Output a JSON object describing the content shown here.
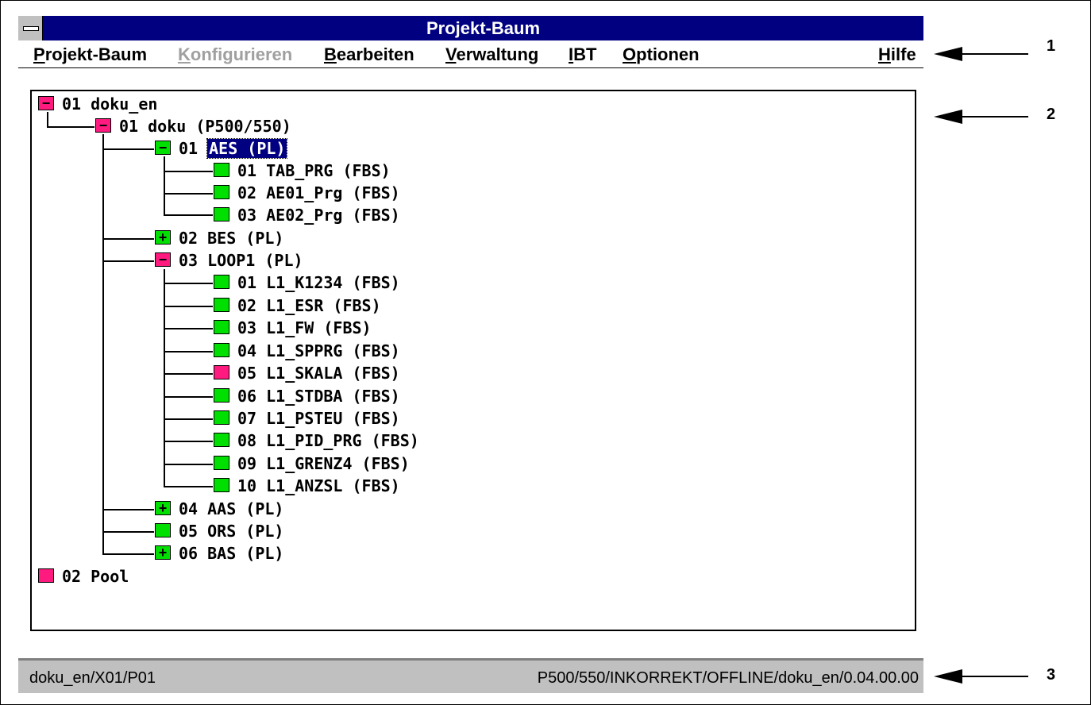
{
  "window": {
    "title": "Projekt-Baum"
  },
  "menubar": {
    "items": [
      {
        "label": "Projekt-Baum",
        "mnemonic": "P",
        "rest": "rojekt-Baum",
        "enabled": true
      },
      {
        "label": "Konfigurieren",
        "mnemonic": "K",
        "rest": "onfigurieren",
        "enabled": false
      },
      {
        "label": "Bearbeiten",
        "mnemonic": "B",
        "rest": "earbeiten",
        "enabled": true
      },
      {
        "label": "Verwaltung",
        "mnemonic": "V",
        "rest": "erwaltung",
        "enabled": true
      },
      {
        "label": "IBT",
        "mnemonic": "I",
        "rest": "BT",
        "enabled": true
      },
      {
        "label": "Optionen",
        "mnemonic": "O",
        "rest": "ptionen",
        "enabled": true
      },
      {
        "label": "Hilfe",
        "mnemonic": "H",
        "rest": "ilfe",
        "enabled": true
      }
    ]
  },
  "tree": {
    "nodes": [
      {
        "label": "01  doku_en",
        "state": "expanded",
        "color": "pink",
        "icon": "minus-icon"
      },
      {
        "label": "01  doku (P500/550)",
        "state": "expanded",
        "color": "pink",
        "icon": "minus-icon"
      },
      {
        "label": "01  ",
        "label_selected": "AES (PL)",
        "state": "expanded",
        "color": "green",
        "icon": "minus-icon",
        "selected": true
      },
      {
        "label": "01  TAB_PRG (FBS)",
        "state": "leaf",
        "color": "green"
      },
      {
        "label": "02  AE01_Prg (FBS)",
        "state": "leaf",
        "color": "green"
      },
      {
        "label": "03  AE02_Prg (FBS)",
        "state": "leaf",
        "color": "green"
      },
      {
        "label": "02  BES (PL)",
        "state": "collapsed",
        "color": "green",
        "icon": "plus-icon"
      },
      {
        "label": "03  LOOP1 (PL)",
        "state": "expanded",
        "color": "pink",
        "icon": "minus-icon"
      },
      {
        "label": "01  L1_K1234 (FBS)",
        "state": "leaf",
        "color": "green"
      },
      {
        "label": "02  L1_ESR (FBS)",
        "state": "leaf",
        "color": "green"
      },
      {
        "label": "03  L1_FW (FBS)",
        "state": "leaf",
        "color": "green"
      },
      {
        "label": "04  L1_SPPRG (FBS)",
        "state": "leaf",
        "color": "green"
      },
      {
        "label": "05  L1_SKALA (FBS)",
        "state": "leaf",
        "color": "pink"
      },
      {
        "label": "06  L1_STDBA (FBS)",
        "state": "leaf",
        "color": "green"
      },
      {
        "label": "07  L1_PSTEU (FBS)",
        "state": "leaf",
        "color": "green"
      },
      {
        "label": "08  L1_PID_PRG (FBS)",
        "state": "leaf",
        "color": "green"
      },
      {
        "label": "09  L1_GRENZ4 (FBS)",
        "state": "leaf",
        "color": "green"
      },
      {
        "label": "10  L1_ANZSL (FBS)",
        "state": "leaf",
        "color": "green"
      },
      {
        "label": "04  AAS (PL)",
        "state": "collapsed",
        "color": "green",
        "icon": "plus-icon"
      },
      {
        "label": "05  ORS (PL)",
        "state": "leaf",
        "color": "green"
      },
      {
        "label": "06  BAS (PL)",
        "state": "collapsed",
        "color": "green",
        "icon": "plus-icon"
      },
      {
        "label": "02  Pool",
        "state": "leaf",
        "color": "pink"
      }
    ]
  },
  "statusbar": {
    "left": "doku_en/X01/P01",
    "right": "P500/550/INKORREKT/OFFLINE/doku_en/0.04.00.00"
  },
  "callouts": {
    "one": "1",
    "two": "2",
    "three": "3"
  },
  "colors": {
    "titlebar": "#000080",
    "green": "#00e000",
    "pink": "#ff1a80",
    "statusbar": "#c0c0c0",
    "disabled": "#a0a0a0"
  }
}
